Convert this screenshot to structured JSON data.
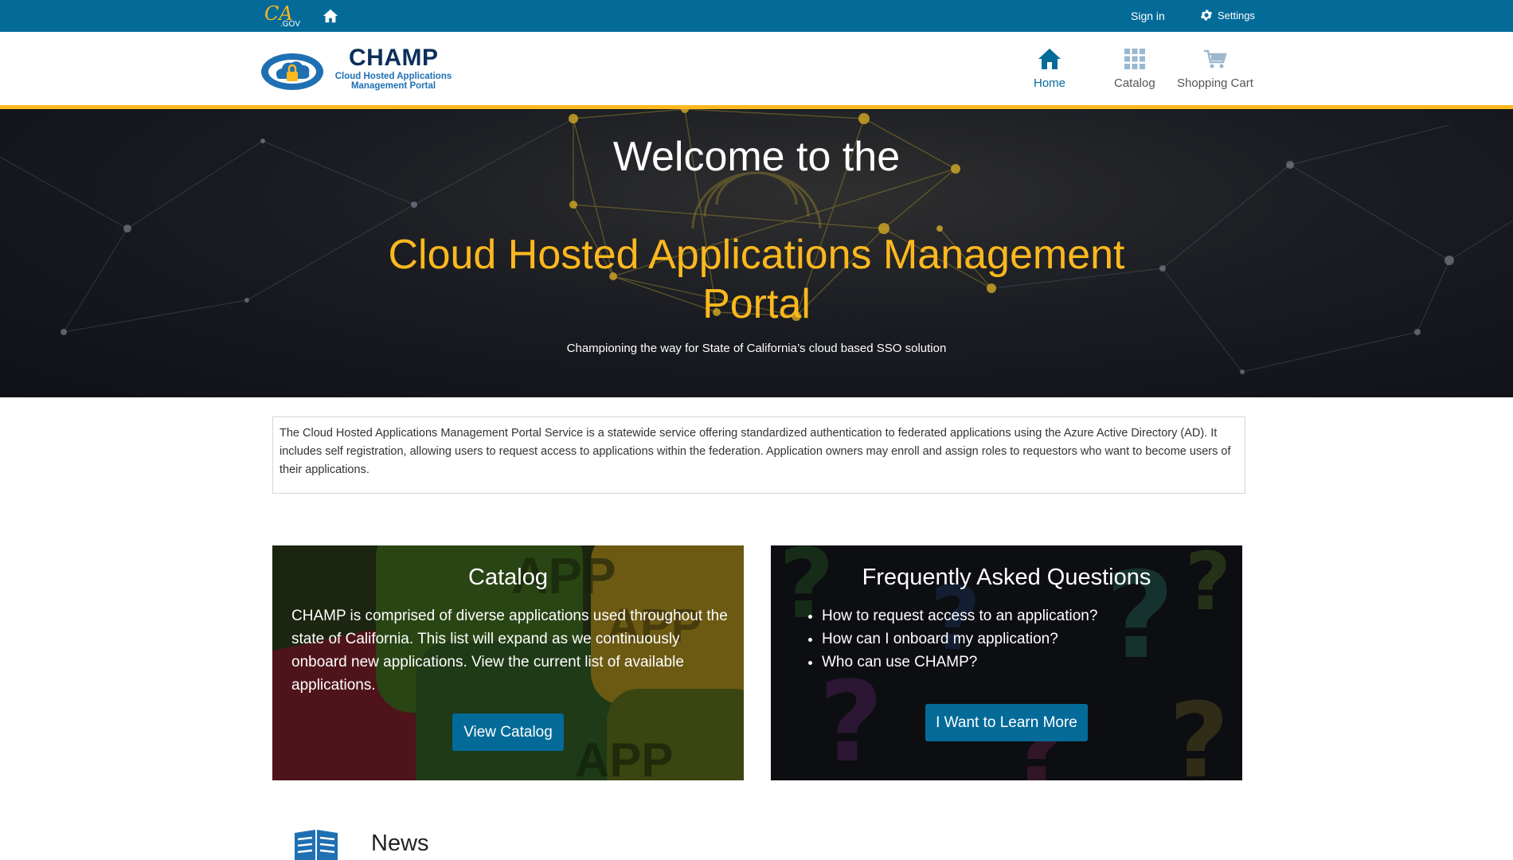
{
  "utility": {
    "ca_logo": "CA.GOV",
    "signin_label": "Sign in",
    "settings_label": "Settings"
  },
  "brand": {
    "title": "CHAMP",
    "subtitle": "Cloud Hosted Applications Management Portal"
  },
  "nav": [
    {
      "label": "Home",
      "icon": "home-icon",
      "active": true
    },
    {
      "label": "Catalog",
      "icon": "grid-icon",
      "active": false
    },
    {
      "label": "Shopping Cart",
      "icon": "cart-icon",
      "active": false
    }
  ],
  "hero": {
    "welcome": "Welcome to the",
    "title": "Cloud Hosted Applications Management Portal",
    "tagline": "Championing the way for State of California’s cloud based SSO solution"
  },
  "intro": {
    "text": "The Cloud Hosted Applications Management Portal Service is a statewide service offering standardized authentication to federated applications using the Azure Active Directory (AD). It includes self registration, allowing users to request access to applications within the federation. Application owners may enroll and assign roles to requestors who want to become users of their applications."
  },
  "catalog_card": {
    "title": "Catalog",
    "text": "CHAMP is comprised of diverse applications used throughout the state of California. This list will expand as we continuously onboard new applications. View the current list of available applications.",
    "button": "View Catalog"
  },
  "faq_card": {
    "title": "Frequently Asked Questions",
    "items": [
      "How to request access to an application?",
      "How can I onboard my application?",
      "Who can use CHAMP?"
    ],
    "button": "I Want to Learn More"
  },
  "news": {
    "title": "News"
  },
  "colors": {
    "primary": "#046b99",
    "accent": "#fdb81e",
    "navy": "#0b2f5c"
  }
}
